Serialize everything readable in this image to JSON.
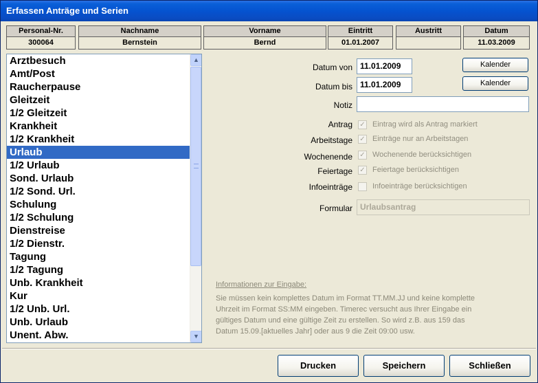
{
  "window": {
    "title": "Erfassen Anträge und Serien"
  },
  "header": {
    "columns": [
      {
        "label": "Personal-Nr.",
        "value": "300064"
      },
      {
        "label": "Nachname",
        "value": "Bernstein"
      },
      {
        "label": "Vorname",
        "value": "Bernd"
      },
      {
        "label": "Eintritt",
        "value": "01.01.2007"
      },
      {
        "label": "Austritt",
        "value": ""
      },
      {
        "label": "Datum",
        "value": "11.03.2009"
      }
    ]
  },
  "list": {
    "items": [
      "Arztbesuch",
      "Amt/Post",
      "Raucherpause",
      "Gleitzeit",
      "1/2 Gleitzeit",
      "Krankheit",
      "1/2 Krankheit",
      "Urlaub",
      "1/2 Urlaub",
      "Sond. Urlaub",
      "1/2 Sond. Url.",
      "Schulung",
      "1/2 Schulung",
      "Dienstreise",
      "1/2 Dienstr.",
      "Tagung",
      "1/2 Tagung",
      "Unb. Krankheit",
      "Kur",
      "1/2 Unb. Url.",
      "Unb. Urlaub",
      "Unent. Abw."
    ],
    "selected": "Urlaub"
  },
  "form": {
    "datum_von_label": "Datum von",
    "datum_von_value": "11.01.2009",
    "datum_bis_label": "Datum bis",
    "datum_bis_value": "11.01.2009",
    "kalender_label": "Kalender",
    "notiz_label": "Notiz",
    "notiz_value": "",
    "antrag_label": "Antrag",
    "antrag_text": "Eintrag wird als Antrag markiert",
    "arbeitstage_label": "Arbeitstage",
    "arbeitstage_text": "Einträge nur an Arbeitstagen",
    "wochenende_label": "Wochenende",
    "wochenende_text": "Wochenende berücksichtigen",
    "feiertage_label": "Feiertage",
    "feiertage_text": "Feiertage  berücksichtigen",
    "infoeintraege_label": "Infoeinträge",
    "infoeintraege_text": "Infoeinträge  berücksichtigen",
    "formular_label": "Formular",
    "formular_value": "Urlaubsantrag"
  },
  "info": {
    "heading": "Informationen zur Eingabe:",
    "lines": [
      "Sie müssen kein komplettes Datum im Format TT.MM.JJ und keine komplette",
      "Uhrzeit im Format SS:MM eingeben. Timerec versucht aus Ihrer Eingabe ein",
      "gültiges Datum und eine gültige Zeit zu erstellen. So wird z.B. aus 159 das",
      "Datum 15.09.[aktuelles Jahr] oder aus 9 die Zeit 09:00  usw."
    ]
  },
  "buttons": {
    "drucken": "Drucken",
    "speichern": "Speichern",
    "schliessen": "Schließen"
  },
  "icons": {
    "scroll_up": "chevron-up-icon",
    "scroll_down": "chevron-down-icon",
    "check": "check-icon"
  }
}
